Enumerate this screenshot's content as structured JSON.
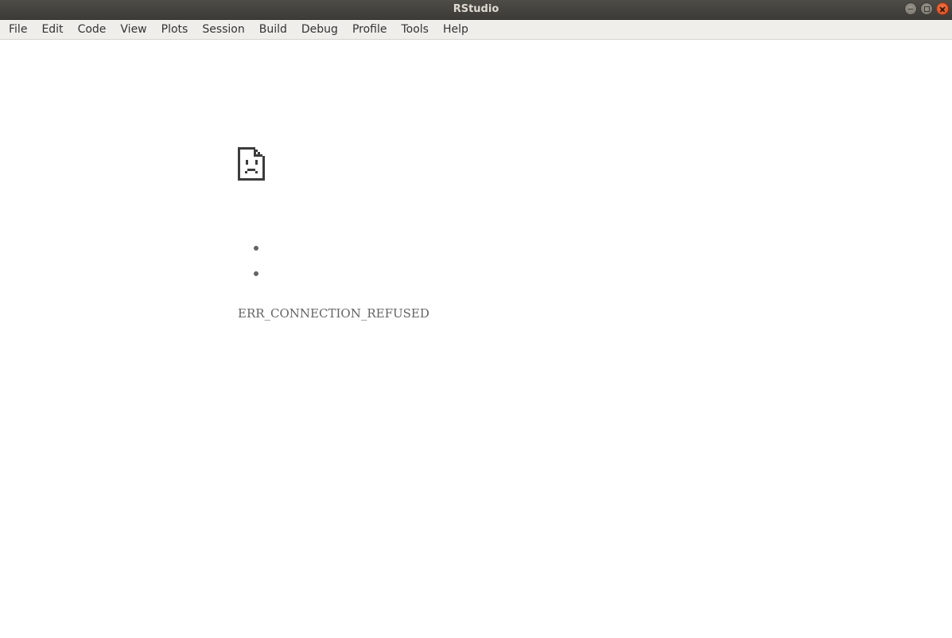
{
  "window": {
    "title": "RStudio",
    "controls": [
      "minimize-icon",
      "maximize-icon",
      "close-icon"
    ]
  },
  "menubar": {
    "items": [
      {
        "label": "File"
      },
      {
        "label": "Edit"
      },
      {
        "label": "Code"
      },
      {
        "label": "View"
      },
      {
        "label": "Plots"
      },
      {
        "label": "Session"
      },
      {
        "label": "Build"
      },
      {
        "label": "Debug"
      },
      {
        "label": "Profile"
      },
      {
        "label": "Tools"
      },
      {
        "label": "Help"
      }
    ]
  },
  "error_page": {
    "icon": "sad-document-icon",
    "suggestions": [
      "",
      ""
    ],
    "error_code": "ERR_CONNECTION_REFUSED"
  },
  "colors": {
    "titlebar": "#3c3b37",
    "title_text": "#dfdbd2",
    "menubar": "#f0eeeb",
    "close_button": "#e0572a",
    "error_text": "#646464"
  }
}
